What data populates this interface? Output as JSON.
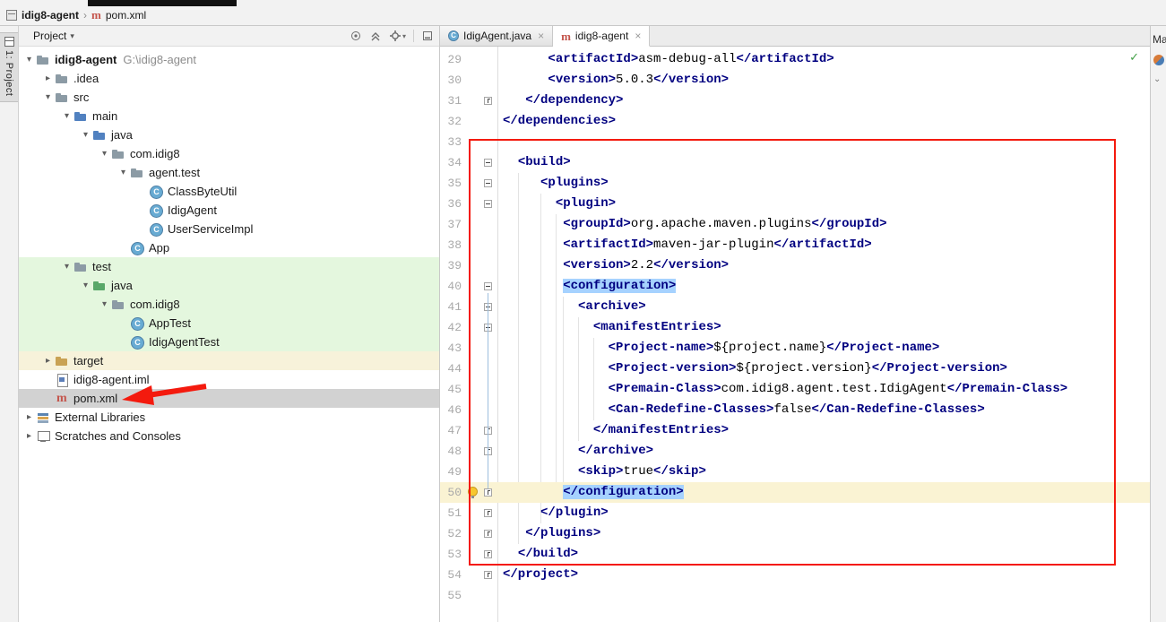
{
  "colors": {
    "tag-navy": "#000080",
    "selection-blue": "#a6d2ff",
    "caret-row": "#faf3d3",
    "test-green": "#e4f7de",
    "excluded-yellow": "#f7f2da",
    "selected-gray": "#d2d2d2",
    "annotation-red": "#f41a0e",
    "maven-red": "#c4554c"
  },
  "glyphs": {
    "expanded": "▾",
    "collapsed": "▸",
    "close": "×",
    "separator": "›",
    "dropdown": "▾",
    "chevron_down": "⌄",
    "check": "✓"
  },
  "titlebar": {
    "breadcrumbs": [
      {
        "label": "idig8-agent",
        "icon": "project"
      },
      {
        "label": "pom.xml",
        "icon": "maven"
      }
    ]
  },
  "left_toolbar": {
    "project_tab": "1: Project"
  },
  "project_panel": {
    "header": {
      "title": "Project",
      "icons": [
        "locate",
        "collapse-all",
        "settings",
        "hide"
      ]
    },
    "tree": [
      {
        "label": "idig8-agent",
        "suffix": "G:\\idig8-agent",
        "icon": "folder",
        "depth": 0,
        "chevron": "expanded",
        "bold": true
      },
      {
        "label": ".idea",
        "icon": "folder",
        "depth": 1,
        "chevron": "collapsed"
      },
      {
        "label": "src",
        "icon": "folder",
        "depth": 1,
        "chevron": "expanded"
      },
      {
        "label": "main",
        "icon": "folder-src",
        "depth": 2,
        "chevron": "expanded"
      },
      {
        "label": "java",
        "icon": "folder-src",
        "depth": 3,
        "chevron": "expanded"
      },
      {
        "label": "com.idig8",
        "icon": "package",
        "depth": 4,
        "chevron": "expanded"
      },
      {
        "label": "agent.test",
        "icon": "package",
        "depth": 5,
        "chevron": "expanded"
      },
      {
        "label": "ClassByteUtil",
        "icon": "class",
        "depth": 6
      },
      {
        "label": "IdigAgent",
        "icon": "class",
        "depth": 6
      },
      {
        "label": "UserServiceImpl",
        "icon": "class",
        "depth": 6
      },
      {
        "label": "App",
        "icon": "class",
        "depth": 5
      },
      {
        "label": "test",
        "icon": "folder",
        "depth": 2,
        "chevron": "expanded",
        "row": "green"
      },
      {
        "label": "java",
        "icon": "folder-test",
        "depth": 3,
        "chevron": "expanded",
        "row": "green"
      },
      {
        "label": "com.idig8",
        "icon": "package",
        "depth": 4,
        "chevron": "expanded",
        "row": "green"
      },
      {
        "label": "AppTest",
        "icon": "class",
        "depth": 5,
        "row": "green"
      },
      {
        "label": "IdigAgentTest",
        "icon": "class",
        "depth": 5,
        "row": "green"
      },
      {
        "label": "target",
        "icon": "folder-excluded",
        "depth": 1,
        "chevron": "collapsed",
        "row": "yellow"
      },
      {
        "label": "idig8-agent.iml",
        "icon": "iml",
        "depth": 1
      },
      {
        "label": "pom.xml",
        "icon": "maven",
        "depth": 1,
        "row": "selected"
      },
      {
        "label": "External Libraries",
        "icon": "libraries",
        "depth": 0,
        "chevron": "collapsed"
      },
      {
        "label": "Scratches and Consoles",
        "icon": "scratches",
        "depth": 0,
        "chevron": "collapsed"
      }
    ]
  },
  "editor": {
    "tabs": [
      {
        "label": "IdigAgent.java",
        "icon": "class",
        "active": false
      },
      {
        "label": "idig8-agent",
        "icon": "maven",
        "active": true
      }
    ],
    "inspection_check": "✓",
    "right_bar": {
      "label": "Ma"
    },
    "code": {
      "guides": [
        {
          "ch": 2,
          "from": 35,
          "to": 52
        },
        {
          "ch": 5,
          "from": 36,
          "to": 51
        },
        {
          "ch": 7,
          "from": 37,
          "to": 50
        },
        {
          "ch": 8,
          "from": 41,
          "to": 49
        },
        {
          "ch": 10,
          "from": 42,
          "to": 47
        },
        {
          "ch": 12,
          "from": 43,
          "to": 46
        }
      ],
      "lines": [
        {
          "num": 29,
          "indent": 6,
          "tokens": [
            {
              "t": "tag",
              "s": "<artifactId>"
            },
            {
              "t": "txt",
              "s": "asm-debug-all"
            },
            {
              "t": "tag",
              "s": "</artifactId>"
            }
          ]
        },
        {
          "num": 30,
          "indent": 6,
          "tokens": [
            {
              "t": "tag",
              "s": "<version>"
            },
            {
              "t": "txt",
              "s": "5.0.3"
            },
            {
              "t": "tag",
              "s": "</version>"
            }
          ]
        },
        {
          "num": 31,
          "indent": 3,
          "fold": "end",
          "tokens": [
            {
              "t": "tag",
              "s": "</dependency>"
            }
          ]
        },
        {
          "num": 32,
          "indent": 0,
          "tokens": [
            {
              "t": "tag",
              "s": "</dependencies>"
            }
          ]
        },
        {
          "num": 33,
          "indent": 0,
          "tokens": []
        },
        {
          "num": 34,
          "indent": 2,
          "fold": "start",
          "tokens": [
            {
              "t": "tag",
              "s": "<build>"
            }
          ]
        },
        {
          "num": 35,
          "indent": 5,
          "fold": "start",
          "tokens": [
            {
              "t": "tag",
              "s": "<plugins>"
            }
          ]
        },
        {
          "num": 36,
          "indent": 7,
          "fold": "start",
          "tokens": [
            {
              "t": "tag",
              "s": "<plugin>"
            }
          ]
        },
        {
          "num": 37,
          "indent": 8,
          "tokens": [
            {
              "t": "tag",
              "s": "<groupId>"
            },
            {
              "t": "txt",
              "s": "org.apache.maven.plugins"
            },
            {
              "t": "tag",
              "s": "</groupId>"
            }
          ]
        },
        {
          "num": 38,
          "indent": 8,
          "tokens": [
            {
              "t": "tag",
              "s": "<artifactId>"
            },
            {
              "t": "txt",
              "s": "maven-jar-plugin"
            },
            {
              "t": "tag",
              "s": "</artifactId>"
            }
          ]
        },
        {
          "num": 39,
          "indent": 8,
          "tokens": [
            {
              "t": "tag",
              "s": "<version>"
            },
            {
              "t": "txt",
              "s": "2.2"
            },
            {
              "t": "tag",
              "s": "</version>"
            }
          ]
        },
        {
          "num": 40,
          "indent": 8,
          "fold": "start",
          "tokens": [
            {
              "t": "tag",
              "s": "<configuration>",
              "hl": true
            }
          ]
        },
        {
          "num": 41,
          "indent": 10,
          "fold": "start",
          "tokens": [
            {
              "t": "tag",
              "s": "<archive>"
            }
          ]
        },
        {
          "num": 42,
          "indent": 12,
          "fold": "start",
          "tokens": [
            {
              "t": "tag",
              "s": "<manifestEntries>"
            }
          ]
        },
        {
          "num": 43,
          "indent": 14,
          "tokens": [
            {
              "t": "tag",
              "s": "<Project-name>"
            },
            {
              "t": "txt",
              "s": "${project.name}"
            },
            {
              "t": "tag",
              "s": "</Project-name>"
            }
          ]
        },
        {
          "num": 44,
          "indent": 14,
          "tokens": [
            {
              "t": "tag",
              "s": "<Project-version>"
            },
            {
              "t": "txt",
              "s": "${project.version}"
            },
            {
              "t": "tag",
              "s": "</Project-version>"
            }
          ]
        },
        {
          "num": 45,
          "indent": 14,
          "tokens": [
            {
              "t": "tag",
              "s": "<Premain-Class>"
            },
            {
              "t": "txt",
              "s": "com.idig8.agent.test.IdigAgent"
            },
            {
              "t": "tag",
              "s": "</Premain-Class>"
            }
          ]
        },
        {
          "num": 46,
          "indent": 14,
          "tokens": [
            {
              "t": "tag",
              "s": "<Can-Redefine-Classes>"
            },
            {
              "t": "txt",
              "s": "false"
            },
            {
              "t": "tag",
              "s": "</Can-Redefine-Classes>"
            }
          ]
        },
        {
          "num": 47,
          "indent": 12,
          "fold": "end",
          "tokens": [
            {
              "t": "tag",
              "s": "</manifestEntries>"
            }
          ]
        },
        {
          "num": 48,
          "indent": 10,
          "fold": "end",
          "tokens": [
            {
              "t": "tag",
              "s": "</archive>"
            }
          ]
        },
        {
          "num": 49,
          "indent": 10,
          "tokens": [
            {
              "t": "tag",
              "s": "<skip>"
            },
            {
              "t": "txt",
              "s": "true"
            },
            {
              "t": "tag",
              "s": "</skip>"
            }
          ]
        },
        {
          "num": 50,
          "indent": 8,
          "fold": "end",
          "caret": true,
          "bulb": true,
          "tokens": [
            {
              "t": "tag",
              "s": "</configuration>",
              "hl": true
            }
          ]
        },
        {
          "num": 51,
          "indent": 5,
          "fold": "end",
          "tokens": [
            {
              "t": "tag",
              "s": "</plugin>"
            }
          ]
        },
        {
          "num": 52,
          "indent": 3,
          "fold": "end",
          "tokens": [
            {
              "t": "tag",
              "s": "</plugins>"
            }
          ]
        },
        {
          "num": 53,
          "indent": 2,
          "fold": "end",
          "tokens": [
            {
              "t": "tag",
              "s": "</build>"
            }
          ]
        },
        {
          "num": 54,
          "indent": 0,
          "fold": "end",
          "tokens": [
            {
              "t": "tag",
              "s": "</project>"
            }
          ]
        },
        {
          "num": 55,
          "indent": 0,
          "tokens": []
        }
      ]
    }
  }
}
